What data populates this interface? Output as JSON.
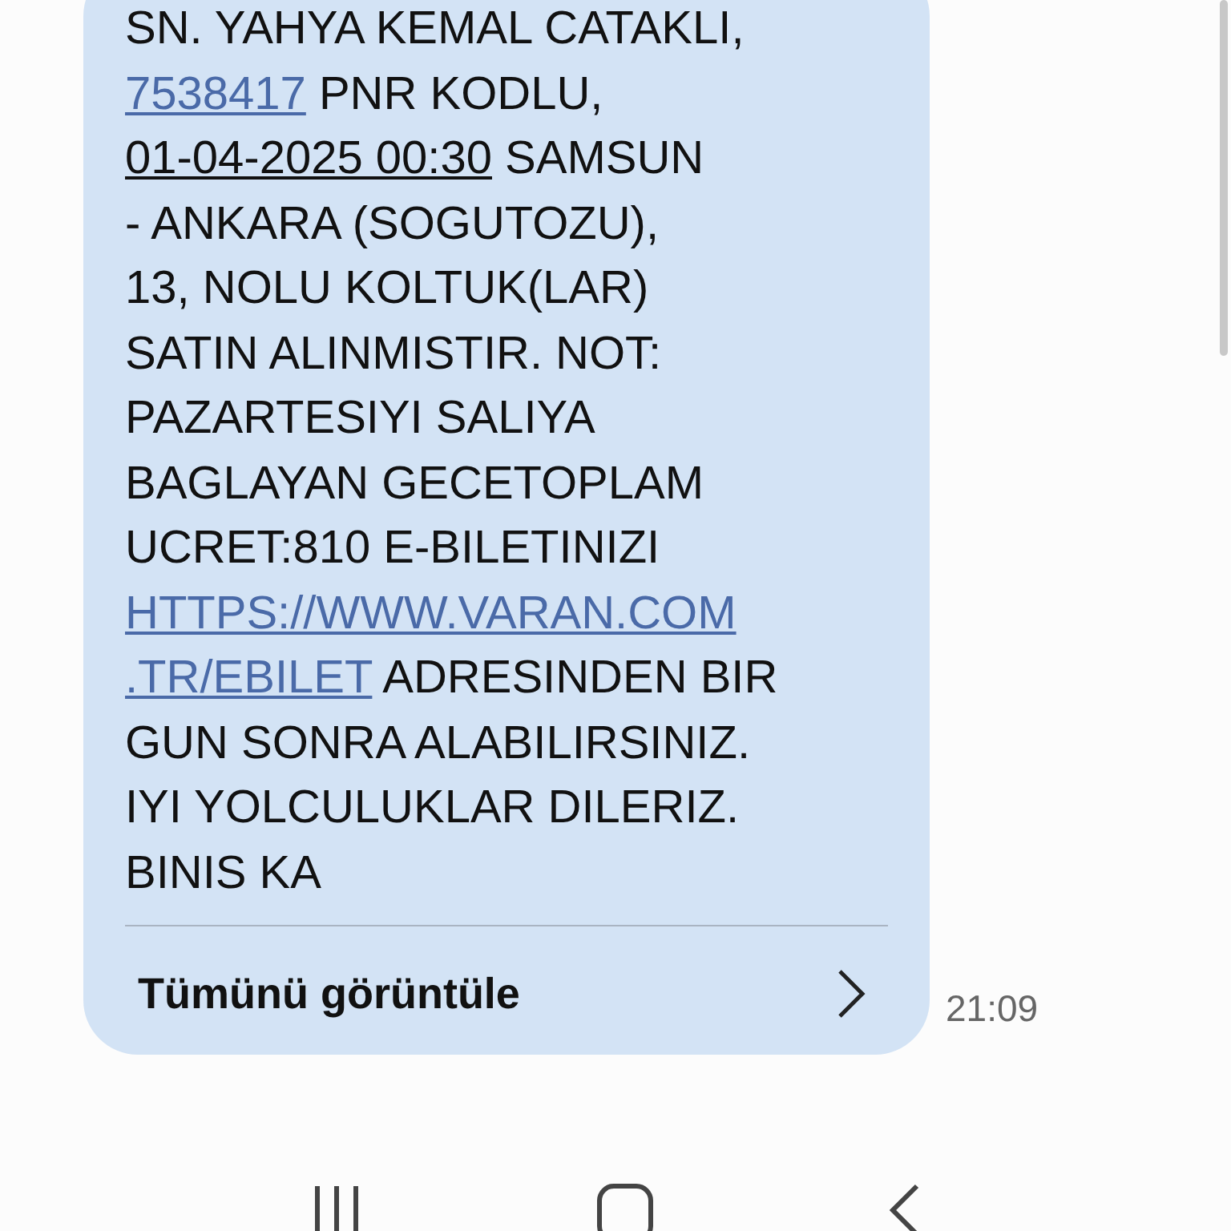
{
  "message": {
    "lines": [
      [
        {
          "kind": "text",
          "text": "SN. YAHYA KEMAL CATAKLI,"
        }
      ],
      [
        {
          "kind": "link",
          "text": "7538417"
        },
        {
          "kind": "text",
          "text": " PNR KODLU,"
        }
      ],
      [
        {
          "kind": "date",
          "text": "01-04-2025 00:30"
        },
        {
          "kind": "text",
          "text": " SAMSUN"
        }
      ],
      [
        {
          "kind": "text",
          "text": "- ANKARA (SOGUTOZU),"
        }
      ],
      [
        {
          "kind": "text",
          "text": "13, NOLU KOLTUK(LAR)"
        }
      ],
      [
        {
          "kind": "text",
          "text": "SATIN ALINMISTIR. NOT:"
        }
      ],
      [
        {
          "kind": "text",
          "text": "PAZARTESIYI SALIYA"
        }
      ],
      [
        {
          "kind": "text",
          "text": "BAGLAYAN GECETOPLAM"
        }
      ],
      [
        {
          "kind": "text",
          "text": "UCRET:810 E-BILETINIZI"
        }
      ],
      [
        {
          "kind": "link",
          "text": "HTTPS://WWW.VARAN.COM"
        }
      ],
      [
        {
          "kind": "link",
          "text": ".TR/EBILET"
        },
        {
          "kind": "text",
          "text": " ADRESINDEN BIR"
        }
      ],
      [
        {
          "kind": "text",
          "text": "GUN SONRA ALABILIRSINIZ."
        }
      ],
      [
        {
          "kind": "text",
          "text": "IYI YOLCULUKLAR DILERIZ."
        }
      ],
      [
        {
          "kind": "text",
          "text": "BINIS KA"
        }
      ]
    ],
    "view_all": "Tümünü görüntüle",
    "time": "21:09"
  }
}
